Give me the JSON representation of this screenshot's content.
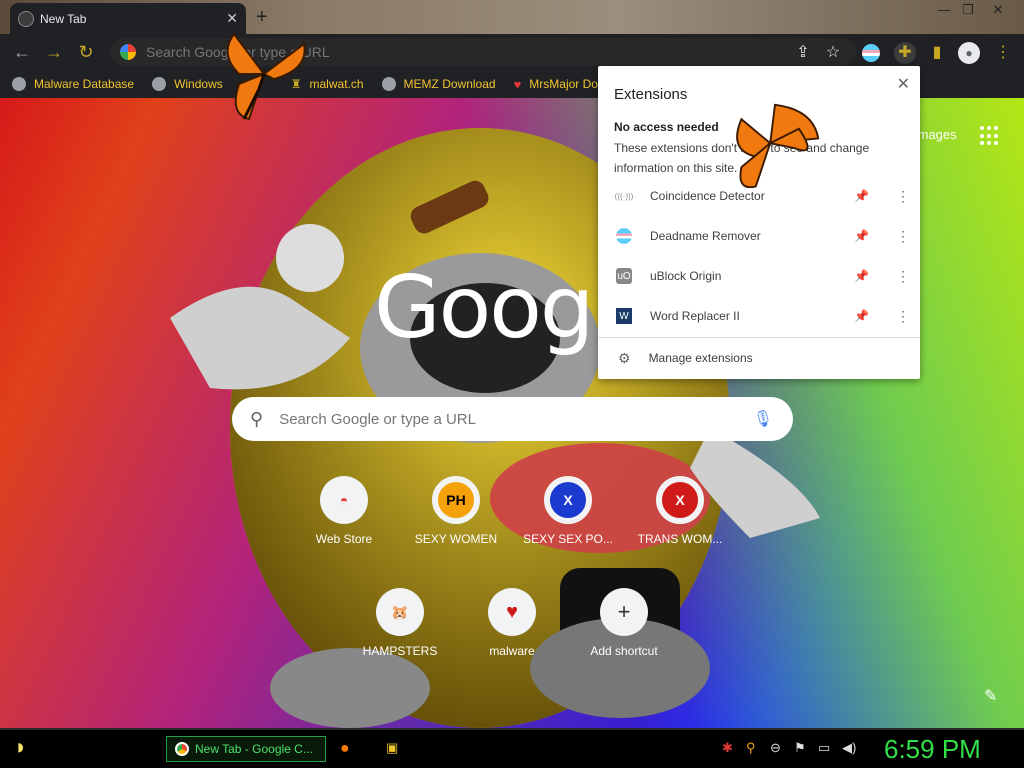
{
  "window": {
    "tab_title": "New Tab",
    "tab_close": "✕",
    "new_tab": "+",
    "min": "—",
    "max": "❐",
    "close": "✕"
  },
  "toolbar": {
    "back": "←",
    "forward": "→",
    "reload": "↻",
    "omnibox_placeholder": "Search Google or type a URL",
    "share": "⇪",
    "star": "☆",
    "extensions": "✚",
    "sidepanel": "▮",
    "profile": "●",
    "menu": "⋮"
  },
  "bookmarks": [
    {
      "label": "Malware Database",
      "icon": "globe-icon"
    },
    {
      "label": "Windows",
      "icon": "globe-icon"
    },
    {
      "label": "malwat.ch",
      "icon": "wizard-icon"
    },
    {
      "label": "MEMZ Download",
      "icon": "globe-icon"
    },
    {
      "label": "MrsMajor Dow",
      "icon": "heart-icon"
    }
  ],
  "page": {
    "logo": "Googl",
    "images_link": "Images",
    "search_placeholder": "Search Google or type a URL",
    "shortcuts": [
      {
        "label": "Web Store",
        "tile": "◓",
        "tile_color": "#ea4335"
      },
      {
        "label": "SEXY WOMEN",
        "tile": "PH",
        "tile_color": "#000"
      },
      {
        "label": "SEXY SEX PO...",
        "tile": "X",
        "tile_color": "#1a3ad0"
      },
      {
        "label": "TRANS WOM...",
        "tile": "X",
        "tile_color": "#d01a1a"
      },
      {
        "label": "HAMPSTERS",
        "tile": "🐹",
        "tile_color": "#333"
      },
      {
        "label": "malware",
        "tile": "♥",
        "tile_color": "#d01a1a"
      },
      {
        "label": "Add shortcut",
        "tile": "+",
        "tile_color": "#333"
      }
    ]
  },
  "extensions_popup": {
    "title": "Extensions",
    "close": "✕",
    "section": "No access needed",
    "description": "These extensions don't need to see and change information on this site.",
    "items": [
      {
        "name": "Coincidence Detector",
        "icon": "(((·)))",
        "pinned": false
      },
      {
        "name": "Deadname Remover",
        "icon": "≡",
        "pinned": true
      },
      {
        "name": "uBlock Origin",
        "icon": "uO",
        "pinned": false
      },
      {
        "name": "Word Replacer II",
        "icon": "W",
        "pinned": false
      }
    ],
    "manage": "Manage extensions",
    "pin_glyph": "📌",
    "more_glyph": "⋮",
    "gear_glyph": "⚙"
  },
  "taskbar": {
    "start": "◗",
    "task_label": "New Tab - Google C...",
    "clock": "6:59 PM"
  },
  "colors": {
    "accent_yellow": "#f0c330",
    "taskbar_green": "#33e04a",
    "pin_active": "#1a73e8"
  }
}
